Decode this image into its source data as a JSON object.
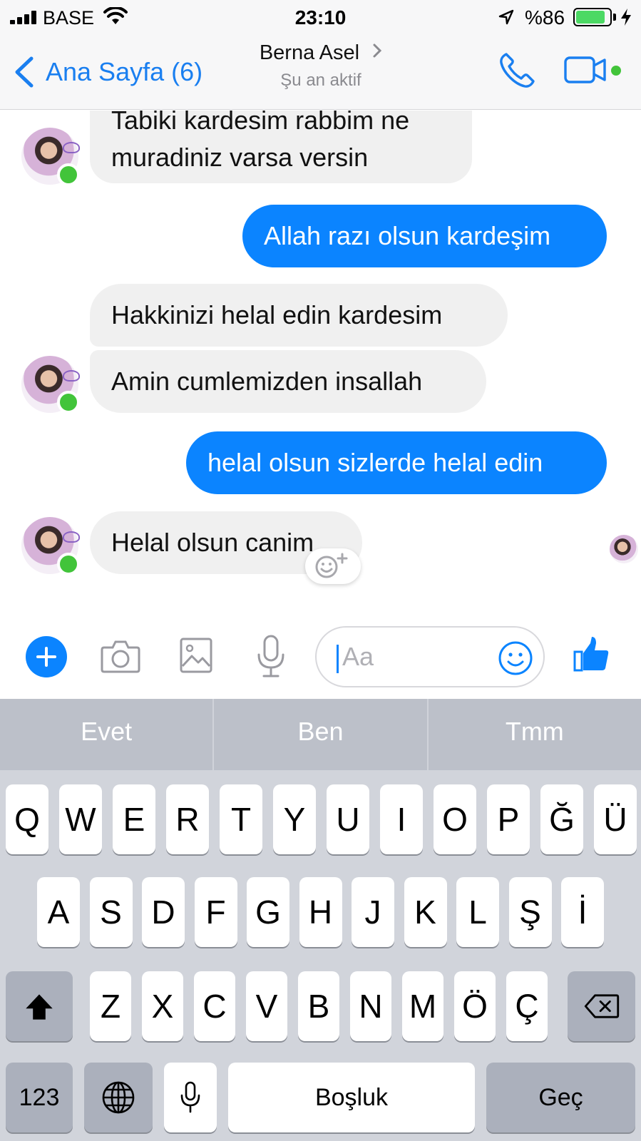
{
  "status_bar": {
    "carrier": "BASE",
    "time": "23:10",
    "battery_percent": "%86",
    "battery_level": 0.86
  },
  "nav": {
    "back_label": "Ana Sayfa (6)",
    "contact_name": "Berna Asel",
    "contact_status": "Şu an aktif"
  },
  "messages": [
    {
      "direction": "in",
      "text_line1": "Tabiki kardesim rabbim ne",
      "text_line2": "muradiniz varsa versin"
    },
    {
      "direction": "out",
      "text": "Allah razı olsun kardeşim"
    },
    {
      "direction": "in",
      "text": "Hakkinizi helal edin kardesim"
    },
    {
      "direction": "in",
      "text": "Amin cumlemizden insallah"
    },
    {
      "direction": "out",
      "text": "helal olsun sizlerde helal edin"
    },
    {
      "direction": "in",
      "text": "Helal olsun canim"
    }
  ],
  "composer": {
    "placeholder": "Aa"
  },
  "keyboard": {
    "suggestions": [
      "Evet",
      "Ben",
      "Tmm"
    ],
    "row1": [
      "Q",
      "W",
      "E",
      "R",
      "T",
      "Y",
      "U",
      "I",
      "O",
      "P",
      "Ğ",
      "Ü"
    ],
    "row2": [
      "A",
      "S",
      "D",
      "F",
      "G",
      "H",
      "J",
      "K",
      "L",
      "Ş",
      "İ"
    ],
    "row3": [
      "Z",
      "X",
      "C",
      "V",
      "B",
      "N",
      "M",
      "Ö",
      "Ç"
    ],
    "numbers_label": "123",
    "space_label": "Boşluk",
    "return_label": "Geç"
  },
  "colors": {
    "accent": "#0b84ff",
    "presence": "#42c43a",
    "incoming_bubble": "#f0f0f0"
  },
  "icons": [
    "signal-icon",
    "wifi-icon",
    "location-arrow-icon",
    "battery-icon",
    "charging-bolt-icon",
    "back-chevron-icon",
    "phone-icon",
    "video-icon",
    "plus-icon",
    "camera-icon",
    "image-icon",
    "microphone-icon",
    "emoji-icon",
    "thumbs-up-icon",
    "add-reaction-icon",
    "shift-icon",
    "backspace-icon",
    "globe-icon",
    "dictation-icon"
  ]
}
